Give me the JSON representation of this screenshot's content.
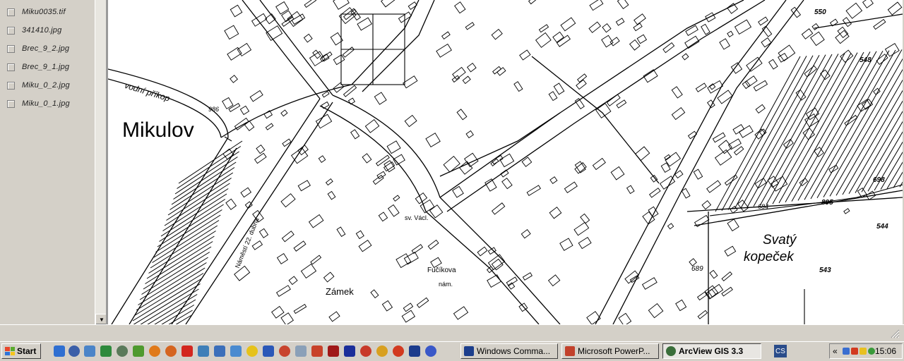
{
  "toc": {
    "items": [
      {
        "label": "Miku0035.tif"
      },
      {
        "label": "341410.jpg"
      },
      {
        "label": "Brec_9_2.jpg"
      },
      {
        "label": "Brec_9_1.jpg"
      },
      {
        "label": "Miku_0_2.jpg"
      },
      {
        "label": "Miku_0_1.jpg"
      }
    ]
  },
  "map": {
    "town_label": "Mikulov",
    "hill_label_1": "Svatý",
    "hill_label_2": "kopeček",
    "ditch_label": "vodní příkop",
    "castle_label": "Zámek",
    "square_label": "Fučíkova",
    "square_label_2": "nám.",
    "church_label": "sv. Václ.",
    "street_label": "Náměstí 22. dubna",
    "parcel_numbers": [
      "550",
      "548",
      "698",
      "895",
      "684",
      "544",
      "543",
      "689",
      "986"
    ]
  },
  "taskbar": {
    "start_label": "Start",
    "tasks": [
      {
        "label": "Windows Comma...",
        "icon_color": "#1c3e8c",
        "active": false
      },
      {
        "label": "Microsoft PowerP...",
        "icon_color": "#c2412b",
        "active": false
      },
      {
        "label": "ArcView GIS 3.3",
        "icon_color": "#3a6e3a",
        "active": true
      }
    ],
    "cs_label": "CS",
    "tray_expand": "«",
    "clock": "15:06"
  },
  "colors": {
    "chrome": "#d4d0c8",
    "map_background": "#ffffff",
    "ink": "#000000"
  }
}
